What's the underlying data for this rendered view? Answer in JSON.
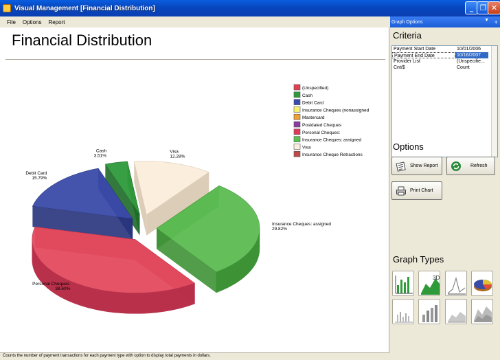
{
  "window": {
    "title": "Visual Management [Financial Distribution]"
  },
  "menu": {
    "file": "File",
    "options": "Options",
    "report": "Report"
  },
  "main": {
    "title": "Financial Distribution"
  },
  "status": {
    "text": "Counts the number of payment transactions for each payment type with option to display total payments in dollars."
  },
  "panel": {
    "header": "Graph Options",
    "criteria_title": "Criteria",
    "criteria": [
      {
        "key": "Payment Start Date",
        "value": "10/01/2006"
      },
      {
        "key": "Payment End Date",
        "value": "10/16/2007"
      },
      {
        "key": "Provider List",
        "value": "(Unspecifie..."
      },
      {
        "key": "Cnt/$",
        "value": "Count"
      }
    ],
    "options_title": "Options",
    "show_report": "Show Report",
    "refresh": "Refresh",
    "print_chart": "Print Chart",
    "graph_types_title": "Graph Types"
  },
  "chart_data": {
    "type": "pie",
    "style": "3d-exploded",
    "legend_position": "top-right",
    "legend": [
      {
        "name": "(Unspecified)",
        "color": "#e04050"
      },
      {
        "name": "Cash",
        "color": "#2e9a3a"
      },
      {
        "name": "Debit Card",
        "color": "#3a4ab0"
      },
      {
        "name": "Insurance Cheques  (nonassigned",
        "color": "#f5f070"
      },
      {
        "name": "Mastercard",
        "color": "#f0a030"
      },
      {
        "name": "Postdated Cheques",
        "color": "#8a3aa0"
      },
      {
        "name": "Personal Cheques:",
        "color": "#e03a5a"
      },
      {
        "name": "Insurance Cheques:  assigned",
        "color": "#5ac050"
      },
      {
        "name": "Visa",
        "color": "#fbeede"
      },
      {
        "name": "Insurance Cheque Retractions",
        "color": "#c04848"
      }
    ],
    "slices": [
      {
        "name": "Visa",
        "label": "Visa",
        "value": 12.28,
        "pct_label": "12.28%",
        "color": "#fbeedc",
        "side": "#d8c8b0"
      },
      {
        "name": "Insurance Cheques:  assigned",
        "label": "Insurance Cheques:  assigned",
        "value": 29.82,
        "pct_label": "29.82%",
        "color": "#5cbc52",
        "side": "#3e9236"
      },
      {
        "name": "Personal Cheques:",
        "label": "Personal Cheques:",
        "value": 38.6,
        "pct_label": "38.60%",
        "color": "#e34a5e",
        "side": "#b8304a"
      },
      {
        "name": "Debit Card",
        "label": "Debit Card",
        "value": 15.79,
        "pct_label": "15.79%",
        "color": "#3a4aa8",
        "side": "#27337c"
      },
      {
        "name": "Cash",
        "label": "Cash",
        "value": 3.51,
        "pct_label": "3.51%",
        "color": "#2e9a3a",
        "side": "#1d6a28"
      }
    ]
  }
}
